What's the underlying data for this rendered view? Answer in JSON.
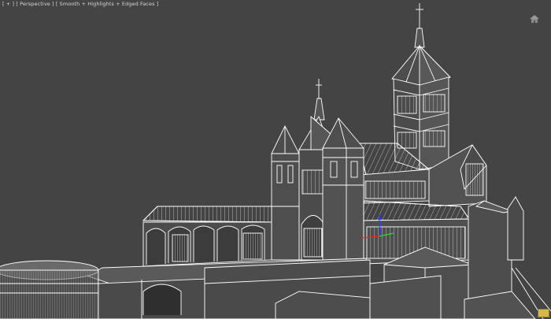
{
  "viewport": {
    "label_parts": [
      "[ + ]",
      "[ Perspective ]",
      "[ Smooth + Highlights + Edged Faces ]"
    ],
    "background": "#444444",
    "wire_color": "#ffffff",
    "face_color": "#5a5a5a"
  },
  "viewcube": {
    "icon": "home-icon"
  },
  "corner_button": {
    "icon": "corner-tool-icon"
  },
  "gizmo": {
    "x_color": "#ff2020",
    "y_color": "#20e020",
    "z_color": "#2040ff"
  }
}
